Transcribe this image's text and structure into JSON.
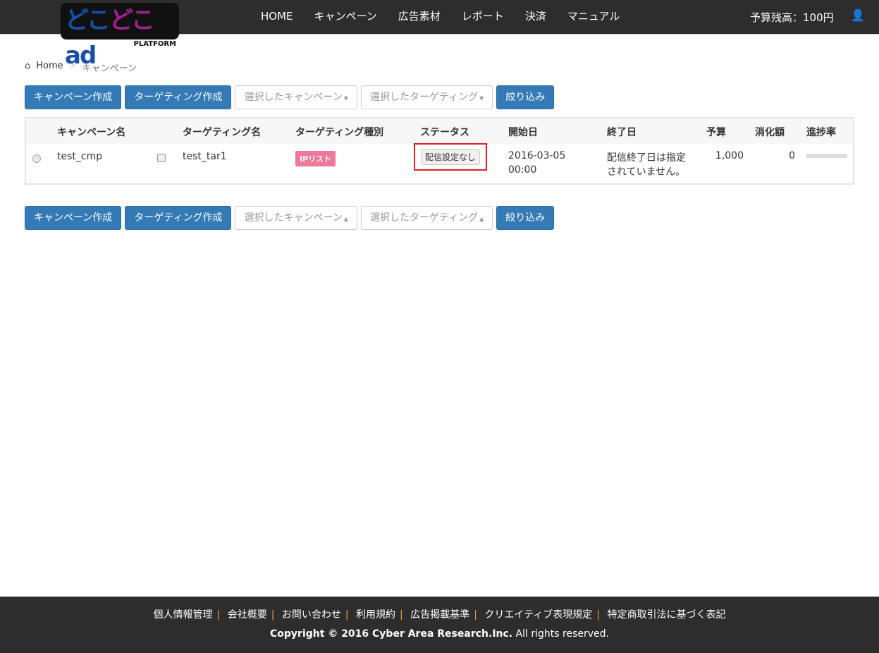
{
  "logo": {
    "text_a": "どこ",
    "text_b": "どこ",
    "text_c": "ad",
    "sub": "PLATFORM"
  },
  "nav": {
    "items": [
      "HOME",
      "キャンペーン",
      "広告素材",
      "レポート",
      "決済",
      "マニュアル"
    ],
    "budget": "予算残高：100円",
    "user_icon": "user-icon"
  },
  "breadcrumb": {
    "home": "Home",
    "sep": ">",
    "current": "キャンペーン"
  },
  "toolbar": {
    "create_campaign": "キャンペーン作成",
    "create_targeting": "ターゲティング作成",
    "selected_campaign": "選択したキャンペーン",
    "selected_targeting": "選択したターゲティング",
    "filter": "絞り込み"
  },
  "table": {
    "headers": [
      "キャンペーン名",
      "ターゲティング名",
      "ターゲティング種別",
      "ステータス",
      "開始日",
      "終了日",
      "予算",
      "消化額",
      "進捗率"
    ],
    "rows": [
      {
        "campaign": "test_cmp",
        "targeting": "test_tar1",
        "type": "IPリスト",
        "status": "配信設定なし",
        "start_date": "2016-03-05",
        "start_time": "00:00",
        "end": "配信終了日は指定",
        "end2": "されていません。",
        "budget": "1,000",
        "spent": "0",
        "progress": 0
      }
    ]
  },
  "footer": {
    "links": [
      "個人情報管理",
      "会社概要",
      "お問い合わせ",
      "利用規約",
      "広告掲載基準",
      "クリエイティブ表現規定",
      "特定商取引法に基づく表記"
    ],
    "copyright_bold": "Copyright © 2016 Cyber Area Research.Inc.",
    "copyright_rest": " All rights reserved."
  }
}
